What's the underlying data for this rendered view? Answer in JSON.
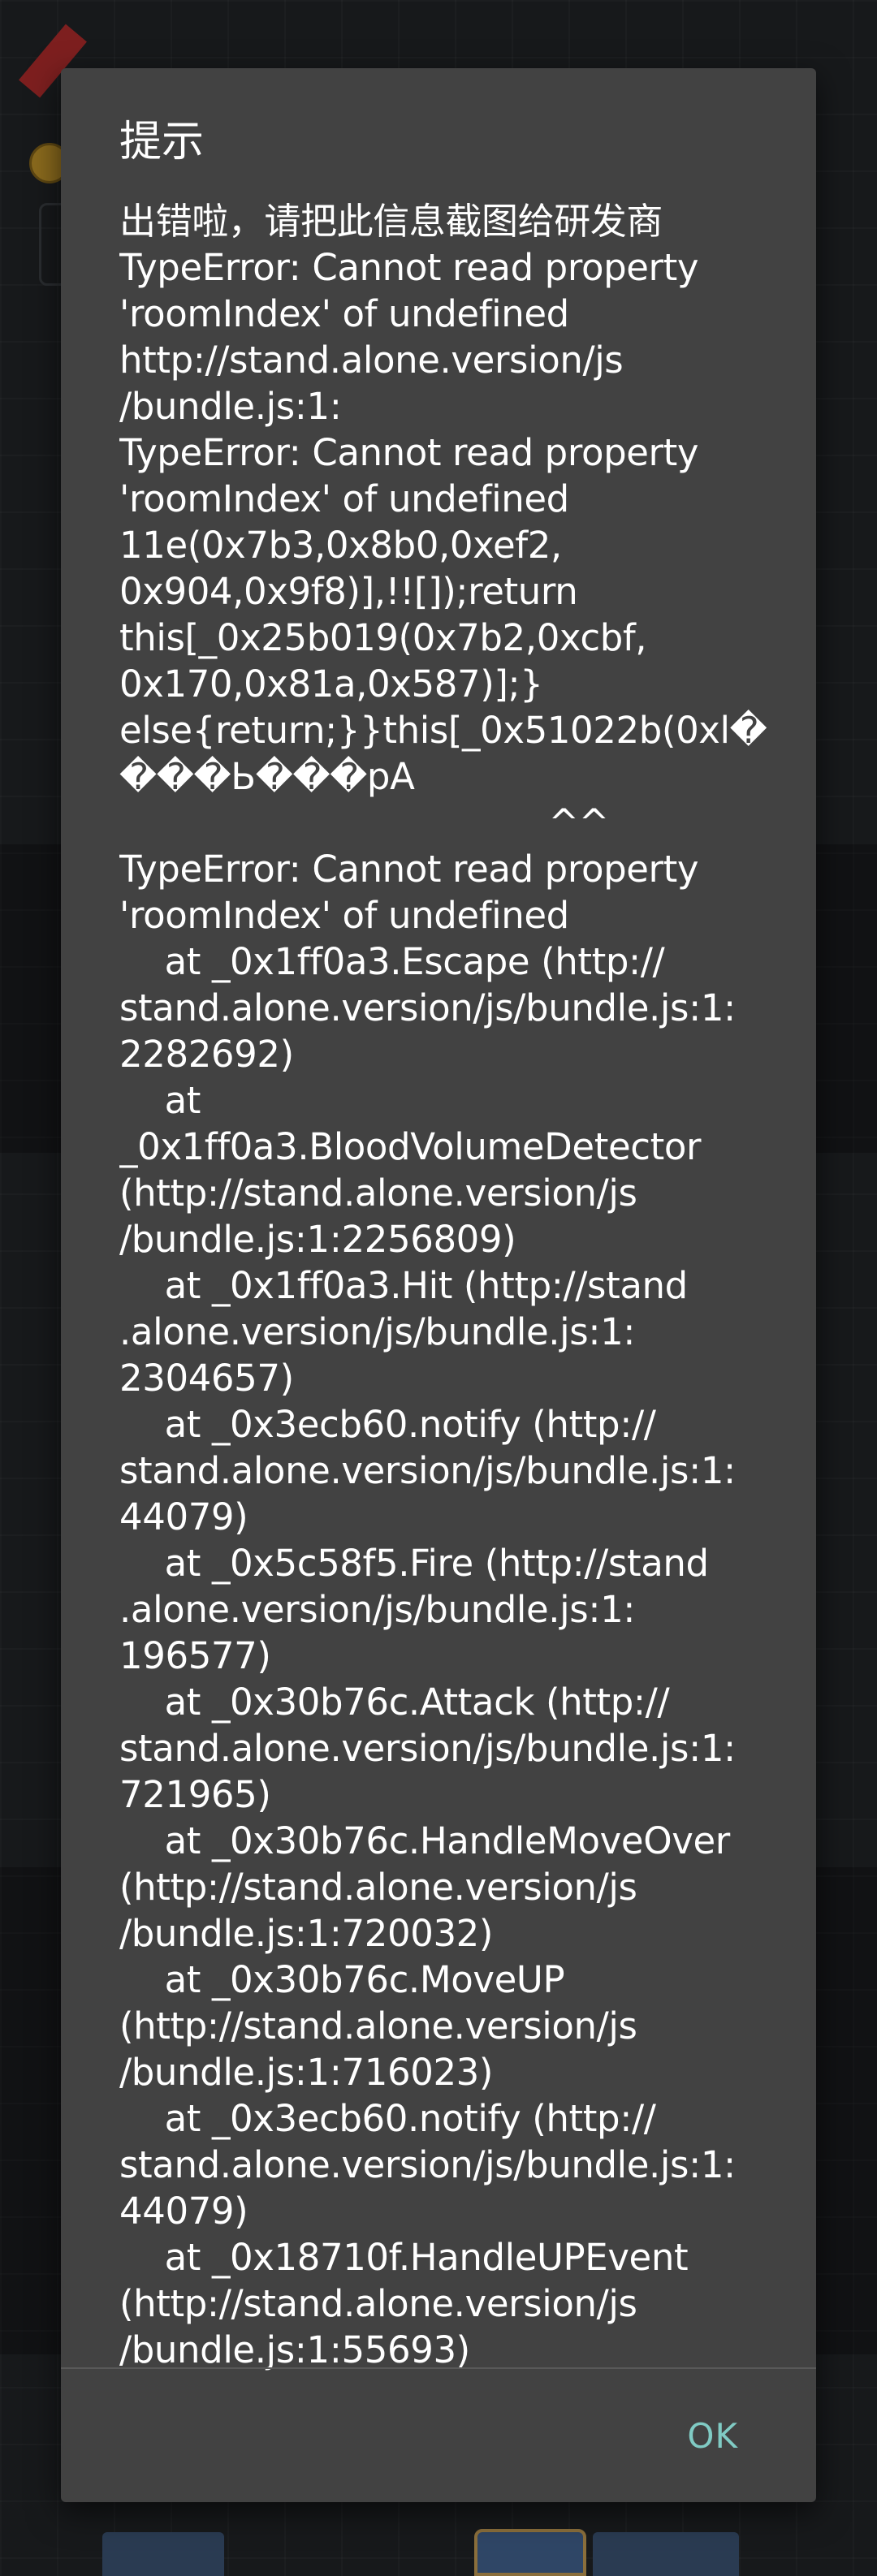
{
  "dialog": {
    "title": "提示",
    "message": "出错啦，请把此信息截图给研发商\nTypeError: Cannot read property\n'roomIndex' of undefined\nhttp://stand.alone.version/js\n/bundle.js:1:\nTypeError: Cannot read property\n'roomIndex' of undefined\n11e(0x7b3,0x8b0,0xef2,\n0x904,0x9f8)],!![]);return\nthis[_0x25b019(0x7b2,0xcbf,\n0x170,0x81a,0x587)];}\nelse{return;}}this[_0x51022b(0xl�\n���Ь���pA\n                                      ^^\nTypeError: Cannot read property\n'roomIndex' of undefined\n    at _0x1ff0a3.Escape (http://\nstand.alone.version/js/bundle.js:1:\n2282692)\n    at\n_0x1ff0a3.BloodVolumeDetector\n(http://stand.alone.version/js\n/bundle.js:1:2256809)\n    at _0x1ff0a3.Hit (http://stand\n.alone.version/js/bundle.js:1:\n2304657)\n    at _0x3ecb60.notify (http://\nstand.alone.version/js/bundle.js:1:\n44079)\n    at _0x5c58f5.Fire (http://stand\n.alone.version/js/bundle.js:1:\n196577)\n    at _0x30b76c.Attack (http://\nstand.alone.version/js/bundle.js:1:\n721965)\n    at _0x30b76c.HandleMoveOver\n(http://stand.alone.version/js\n/bundle.js:1:720032)\n    at _0x30b76c.MoveUP\n(http://stand.alone.version/js\n/bundle.js:1:716023)\n    at _0x3ecb60.notify (http://\nstand.alone.version/js/bundle.js:1:\n44079)\n    at _0x18710f.HandleUPEvent\n(http://stand.alone.version/js\n/bundle.js:1:55693)",
    "ok_label": "OK"
  },
  "colors": {
    "dialog_background": "#424242",
    "text": "#ffffff",
    "accent": "#80cbc4"
  }
}
